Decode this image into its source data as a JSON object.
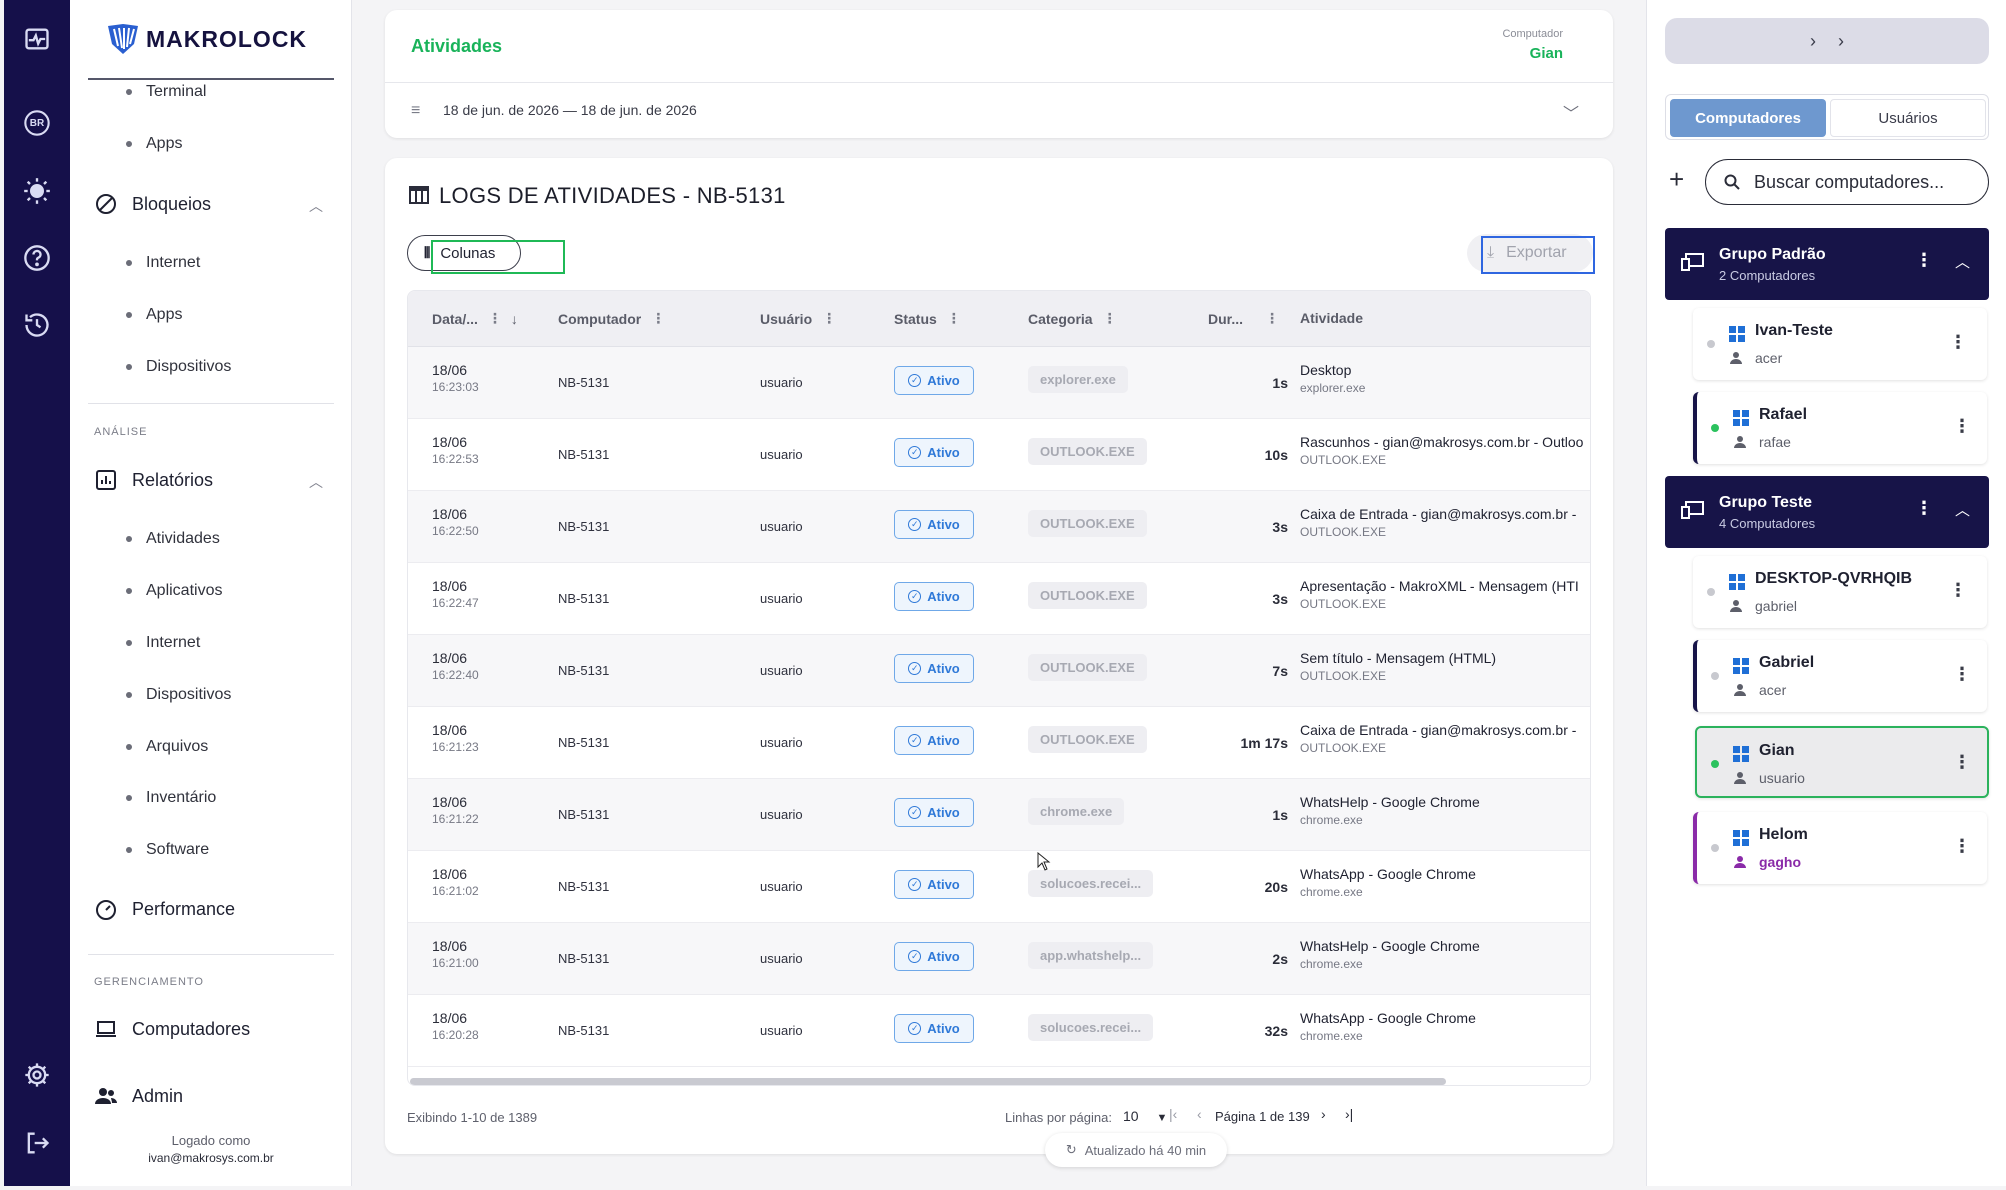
{
  "sidebar": {
    "brand": "MAKROLOCK",
    "items_top": [
      "Terminal",
      "Apps"
    ],
    "bloqueios": {
      "label": "Bloqueios",
      "items": [
        "Internet",
        "Apps",
        "Dispositivos"
      ]
    },
    "section_analise": "ANÁLISE",
    "relatorios": {
      "label": "Relatórios",
      "items": [
        "Atividades",
        "Aplicativos",
        "Internet",
        "Dispositivos",
        "Arquivos",
        "Inventário",
        "Software"
      ]
    },
    "performance": "Performance",
    "section_gerenciamento": "GERENCIAMENTO",
    "computadores": "Computadores",
    "admin": "Admin",
    "logged_label": "Logado como",
    "logged_email": "ivan@makrosys.com.br",
    "rail_badge": "BR"
  },
  "header": {
    "title": "Atividades",
    "computer_label": "Computador",
    "computer_value": "Gian",
    "date_range": "18 de jun. de 2026 — 18 de jun. de 2026"
  },
  "logs": {
    "title": "LOGS DE ATIVIDADES - NB-5131",
    "columns_button": "Colunas",
    "export_button": "Exportar",
    "headers": {
      "date": "Data/...",
      "computer": "Computador",
      "user": "Usuário",
      "status": "Status",
      "category": "Categoria",
      "duration": "Dur...",
      "activity": "Atividade"
    },
    "rows": [
      {
        "date": "18/06",
        "time": "16:23:03",
        "computer": "NB-5131",
        "user": "usuario",
        "status": "Ativo",
        "category": "explorer.exe",
        "duration": "1s",
        "activity": "Desktop",
        "process": "explorer.exe"
      },
      {
        "date": "18/06",
        "time": "16:22:53",
        "computer": "NB-5131",
        "user": "usuario",
        "status": "Ativo",
        "category": "OUTLOOK.EXE",
        "duration": "10s",
        "activity": "Rascunhos - gian@makrosys.com.br - Outloo",
        "process": "OUTLOOK.EXE"
      },
      {
        "date": "18/06",
        "time": "16:22:50",
        "computer": "NB-5131",
        "user": "usuario",
        "status": "Ativo",
        "category": "OUTLOOK.EXE",
        "duration": "3s",
        "activity": "Caixa de Entrada - gian@makrosys.com.br - ",
        "process": "OUTLOOK.EXE"
      },
      {
        "date": "18/06",
        "time": "16:22:47",
        "computer": "NB-5131",
        "user": "usuario",
        "status": "Ativo",
        "category": "OUTLOOK.EXE",
        "duration": "3s",
        "activity": "Apresentação - MakroXML - Mensagem (HTI",
        "process": "OUTLOOK.EXE"
      },
      {
        "date": "18/06",
        "time": "16:22:40",
        "computer": "NB-5131",
        "user": "usuario",
        "status": "Ativo",
        "category": "OUTLOOK.EXE",
        "duration": "7s",
        "activity": "Sem título - Mensagem (HTML)",
        "process": "OUTLOOK.EXE"
      },
      {
        "date": "18/06",
        "time": "16:21:23",
        "computer": "NB-5131",
        "user": "usuario",
        "status": "Ativo",
        "category": "OUTLOOK.EXE",
        "duration": "1m 17s",
        "activity": "Caixa de Entrada - gian@makrosys.com.br - ",
        "process": "OUTLOOK.EXE"
      },
      {
        "date": "18/06",
        "time": "16:21:22",
        "computer": "NB-5131",
        "user": "usuario",
        "status": "Ativo",
        "category": "chrome.exe",
        "duration": "1s",
        "activity": "WhatsHelp - Google Chrome",
        "process": "chrome.exe"
      },
      {
        "date": "18/06",
        "time": "16:21:02",
        "computer": "NB-5131",
        "user": "usuario",
        "status": "Ativo",
        "category": "solucoes.recei...",
        "duration": "20s",
        "activity": "WhatsApp - Google Chrome",
        "process": "chrome.exe"
      },
      {
        "date": "18/06",
        "time": "16:21:00",
        "computer": "NB-5131",
        "user": "usuario",
        "status": "Ativo",
        "category": "app.whatshelp...",
        "duration": "2s",
        "activity": "WhatsHelp - Google Chrome",
        "process": "chrome.exe"
      },
      {
        "date": "18/06",
        "time": "16:20:28",
        "computer": "NB-5131",
        "user": "usuario",
        "status": "Ativo",
        "category": "solucoes.recei...",
        "duration": "32s",
        "activity": "WhatsApp - Google Chrome",
        "process": "chrome.exe"
      }
    ],
    "footer": {
      "showing": "Exibindo 1-10 de 1389",
      "rows_per_page_label": "Linhas por página:",
      "rows_per_page_value": "10",
      "page_label": "Página 1 de 139",
      "updated": "Atualizado há 40 min"
    }
  },
  "right_panel": {
    "tabs": [
      "Computadores",
      "Usuários"
    ],
    "search_placeholder": "Buscar computadores...",
    "groups": [
      {
        "name": "Grupo Padrão",
        "subtitle": "2 Computadores",
        "computers": [
          {
            "name": "Ivan-Teste",
            "user": "acer",
            "online": false
          },
          {
            "name": "Rafael",
            "user": "rafae",
            "online": true
          }
        ]
      },
      {
        "name": "Grupo Teste",
        "subtitle": "4 Computadores",
        "computers": [
          {
            "name": "DESKTOP-QVRHQIB",
            "user": "gabriel",
            "online": false
          },
          {
            "name": "Gabriel",
            "user": "acer",
            "online": false
          },
          {
            "name": "Gian",
            "user": "usuario",
            "online": true
          },
          {
            "name": "Helom",
            "user": "gagho",
            "online": false
          }
        ]
      }
    ]
  },
  "colors": {
    "accent_green": "#19b35a",
    "rail_navy": "#15104a",
    "status_blue": "#2f79d8",
    "tab_blue": "#6e98cf"
  }
}
